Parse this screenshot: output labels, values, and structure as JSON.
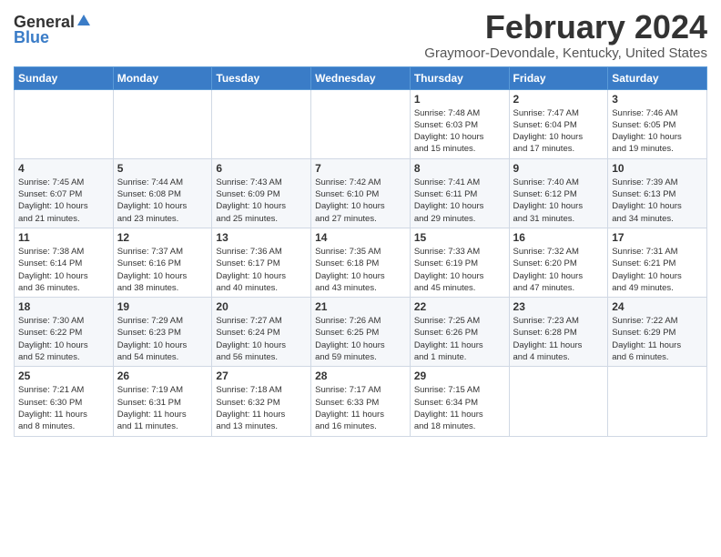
{
  "logo": {
    "general": "General",
    "blue": "Blue"
  },
  "title": "February 2024",
  "subtitle": "Graymoor-Devondale, Kentucky, United States",
  "days_of_week": [
    "Sunday",
    "Monday",
    "Tuesday",
    "Wednesday",
    "Thursday",
    "Friday",
    "Saturday"
  ],
  "weeks": [
    [
      {
        "day": "",
        "detail": ""
      },
      {
        "day": "",
        "detail": ""
      },
      {
        "day": "",
        "detail": ""
      },
      {
        "day": "",
        "detail": ""
      },
      {
        "day": "1",
        "detail": "Sunrise: 7:48 AM\nSunset: 6:03 PM\nDaylight: 10 hours\nand 15 minutes."
      },
      {
        "day": "2",
        "detail": "Sunrise: 7:47 AM\nSunset: 6:04 PM\nDaylight: 10 hours\nand 17 minutes."
      },
      {
        "day": "3",
        "detail": "Sunrise: 7:46 AM\nSunset: 6:05 PM\nDaylight: 10 hours\nand 19 minutes."
      }
    ],
    [
      {
        "day": "4",
        "detail": "Sunrise: 7:45 AM\nSunset: 6:07 PM\nDaylight: 10 hours\nand 21 minutes."
      },
      {
        "day": "5",
        "detail": "Sunrise: 7:44 AM\nSunset: 6:08 PM\nDaylight: 10 hours\nand 23 minutes."
      },
      {
        "day": "6",
        "detail": "Sunrise: 7:43 AM\nSunset: 6:09 PM\nDaylight: 10 hours\nand 25 minutes."
      },
      {
        "day": "7",
        "detail": "Sunrise: 7:42 AM\nSunset: 6:10 PM\nDaylight: 10 hours\nand 27 minutes."
      },
      {
        "day": "8",
        "detail": "Sunrise: 7:41 AM\nSunset: 6:11 PM\nDaylight: 10 hours\nand 29 minutes."
      },
      {
        "day": "9",
        "detail": "Sunrise: 7:40 AM\nSunset: 6:12 PM\nDaylight: 10 hours\nand 31 minutes."
      },
      {
        "day": "10",
        "detail": "Sunrise: 7:39 AM\nSunset: 6:13 PM\nDaylight: 10 hours\nand 34 minutes."
      }
    ],
    [
      {
        "day": "11",
        "detail": "Sunrise: 7:38 AM\nSunset: 6:14 PM\nDaylight: 10 hours\nand 36 minutes."
      },
      {
        "day": "12",
        "detail": "Sunrise: 7:37 AM\nSunset: 6:16 PM\nDaylight: 10 hours\nand 38 minutes."
      },
      {
        "day": "13",
        "detail": "Sunrise: 7:36 AM\nSunset: 6:17 PM\nDaylight: 10 hours\nand 40 minutes."
      },
      {
        "day": "14",
        "detail": "Sunrise: 7:35 AM\nSunset: 6:18 PM\nDaylight: 10 hours\nand 43 minutes."
      },
      {
        "day": "15",
        "detail": "Sunrise: 7:33 AM\nSunset: 6:19 PM\nDaylight: 10 hours\nand 45 minutes."
      },
      {
        "day": "16",
        "detail": "Sunrise: 7:32 AM\nSunset: 6:20 PM\nDaylight: 10 hours\nand 47 minutes."
      },
      {
        "day": "17",
        "detail": "Sunrise: 7:31 AM\nSunset: 6:21 PM\nDaylight: 10 hours\nand 49 minutes."
      }
    ],
    [
      {
        "day": "18",
        "detail": "Sunrise: 7:30 AM\nSunset: 6:22 PM\nDaylight: 10 hours\nand 52 minutes."
      },
      {
        "day": "19",
        "detail": "Sunrise: 7:29 AM\nSunset: 6:23 PM\nDaylight: 10 hours\nand 54 minutes."
      },
      {
        "day": "20",
        "detail": "Sunrise: 7:27 AM\nSunset: 6:24 PM\nDaylight: 10 hours\nand 56 minutes."
      },
      {
        "day": "21",
        "detail": "Sunrise: 7:26 AM\nSunset: 6:25 PM\nDaylight: 10 hours\nand 59 minutes."
      },
      {
        "day": "22",
        "detail": "Sunrise: 7:25 AM\nSunset: 6:26 PM\nDaylight: 11 hours\nand 1 minute."
      },
      {
        "day": "23",
        "detail": "Sunrise: 7:23 AM\nSunset: 6:28 PM\nDaylight: 11 hours\nand 4 minutes."
      },
      {
        "day": "24",
        "detail": "Sunrise: 7:22 AM\nSunset: 6:29 PM\nDaylight: 11 hours\nand 6 minutes."
      }
    ],
    [
      {
        "day": "25",
        "detail": "Sunrise: 7:21 AM\nSunset: 6:30 PM\nDaylight: 11 hours\nand 8 minutes."
      },
      {
        "day": "26",
        "detail": "Sunrise: 7:19 AM\nSunset: 6:31 PM\nDaylight: 11 hours\nand 11 minutes."
      },
      {
        "day": "27",
        "detail": "Sunrise: 7:18 AM\nSunset: 6:32 PM\nDaylight: 11 hours\nand 13 minutes."
      },
      {
        "day": "28",
        "detail": "Sunrise: 7:17 AM\nSunset: 6:33 PM\nDaylight: 11 hours\nand 16 minutes."
      },
      {
        "day": "29",
        "detail": "Sunrise: 7:15 AM\nSunset: 6:34 PM\nDaylight: 11 hours\nand 18 minutes."
      },
      {
        "day": "",
        "detail": ""
      },
      {
        "day": "",
        "detail": ""
      }
    ]
  ]
}
